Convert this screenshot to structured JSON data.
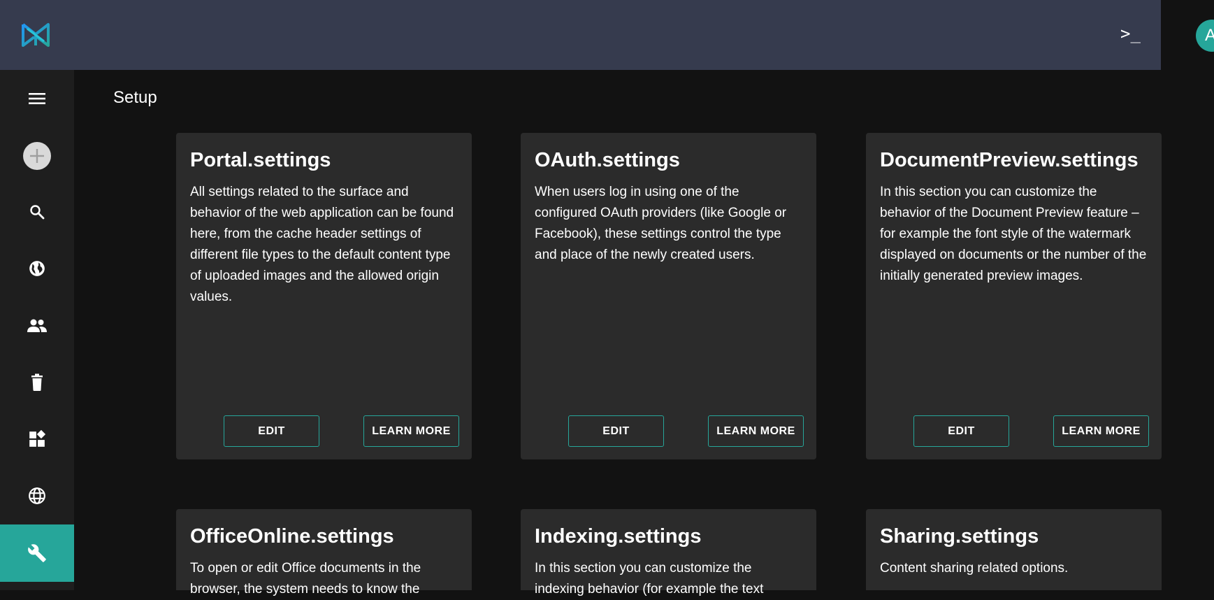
{
  "header": {
    "terminal_label": ">_",
    "avatar_initial": "A"
  },
  "sidebar": {
    "items": [
      {
        "icon": "menu-icon"
      },
      {
        "icon": "add-icon"
      },
      {
        "icon": "search-icon"
      },
      {
        "icon": "globe-icon"
      },
      {
        "icon": "users-icon"
      },
      {
        "icon": "trash-icon"
      },
      {
        "icon": "dashboard-icon"
      },
      {
        "icon": "language-icon"
      },
      {
        "icon": "wrench-icon",
        "active": true
      }
    ]
  },
  "page": {
    "title": "Setup"
  },
  "cards": [
    {
      "title": "Portal.settings",
      "text": "All settings related to the surface and behavior of the web application can be found here, from the cache header settings of different file types to the default content type of uploaded images and the allowed origin values.",
      "edit_label": "EDIT",
      "learn_label": "LEARN MORE"
    },
    {
      "title": "OAuth.settings",
      "text": "When users log in using one of the configured OAuth providers (like Google or Facebook), these settings control the type and place of the newly created users.",
      "edit_label": "EDIT",
      "learn_label": "LEARN MORE"
    },
    {
      "title": "DocumentPreview.settings",
      "text": "In this section you can customize the behavior of the Document Preview feature – for example the font style of the watermark displayed on documents or the number of the initially generated preview images.",
      "edit_label": "EDIT",
      "learn_label": "LEARN MORE"
    },
    {
      "title": "OfficeOnline.settings",
      "text": "To open or edit Office documents in the browser, the system needs to know the"
    },
    {
      "title": "Indexing.settings",
      "text": "In this section you can customize the indexing behavior (for example the text"
    },
    {
      "title": "Sharing.settings",
      "text": "Content sharing related options."
    }
  ],
  "colors": {
    "accent": "#26a69a",
    "header_bg": "#363b4e",
    "card_bg": "#2b2b2b",
    "page_bg": "#121212"
  }
}
